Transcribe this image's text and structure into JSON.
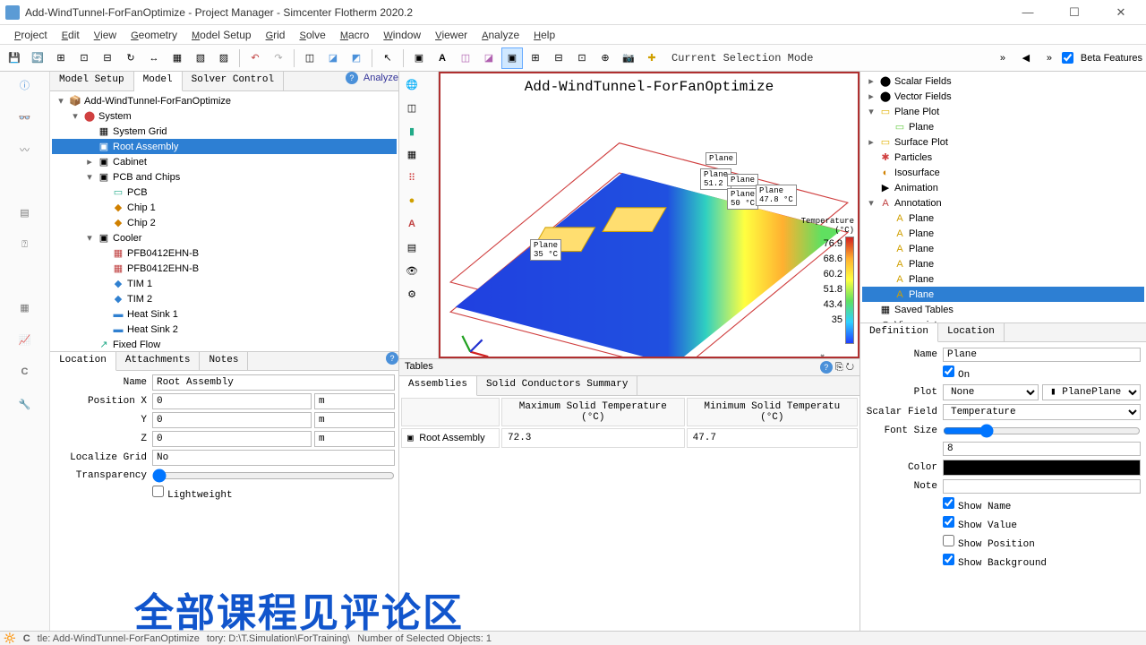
{
  "window": {
    "title": "Add-WindTunnel-ForFanOptimize - Project Manager - Simcenter Flotherm 2020.2"
  },
  "menu": [
    "Project",
    "Edit",
    "View",
    "Geometry",
    "Model Setup",
    "Grid",
    "Solve",
    "Macro",
    "Window",
    "Viewer",
    "Analyze",
    "Help"
  ],
  "toolbar_right": {
    "sel_mode": "Current Selection Mode",
    "beta": "Beta Features"
  },
  "left_tabs": [
    "Model Setup",
    "Model",
    "Solver Control"
  ],
  "left_tabs_active": 1,
  "tree": [
    {
      "depth": 0,
      "exp": "▾",
      "icon": "📦",
      "label": "Add-WindTunnel-ForFanOptimize"
    },
    {
      "depth": 1,
      "exp": "▾",
      "icon": "⬤",
      "label": "System",
      "iconColor": "#d04040"
    },
    {
      "depth": 2,
      "exp": "",
      "icon": "▦",
      "label": "System Grid"
    },
    {
      "depth": 2,
      "exp": "",
      "icon": "▣",
      "label": "Root Assembly",
      "sel": true
    },
    {
      "depth": 2,
      "exp": "▸",
      "icon": "▣",
      "label": "Cabinet"
    },
    {
      "depth": 2,
      "exp": "▾",
      "icon": "▣",
      "label": "PCB and Chips"
    },
    {
      "depth": 3,
      "exp": "",
      "icon": "▭",
      "label": "PCB",
      "iconColor": "#2a8"
    },
    {
      "depth": 3,
      "exp": "",
      "icon": "◆",
      "label": "Chip 1",
      "iconColor": "#d08000"
    },
    {
      "depth": 3,
      "exp": "",
      "icon": "◆",
      "label": "Chip 2",
      "iconColor": "#d08000"
    },
    {
      "depth": 2,
      "exp": "▾",
      "icon": "▣",
      "label": "Cooler"
    },
    {
      "depth": 3,
      "exp": "",
      "icon": "▦",
      "label": "PFB0412EHN-B",
      "iconColor": "#c04040"
    },
    {
      "depth": 3,
      "exp": "",
      "icon": "▦",
      "label": "PFB0412EHN-B",
      "iconColor": "#c04040"
    },
    {
      "depth": 3,
      "exp": "",
      "icon": "◆",
      "label": "TIM 1",
      "iconColor": "#3080d0"
    },
    {
      "depth": 3,
      "exp": "",
      "icon": "◆",
      "label": "TIM 2",
      "iconColor": "#3080d0"
    },
    {
      "depth": 3,
      "exp": "",
      "icon": "▬",
      "label": "Heat Sink 1",
      "iconColor": "#3080d0"
    },
    {
      "depth": 3,
      "exp": "",
      "icon": "▬",
      "label": "Heat Sink 2",
      "iconColor": "#3080d0"
    },
    {
      "depth": 2,
      "exp": "",
      "icon": "↗",
      "label": "Fixed Flow",
      "iconColor": "#2a8"
    }
  ],
  "prop_tabs": [
    "Location",
    "Attachments",
    "Notes"
  ],
  "prop_tabs_active": 0,
  "properties": {
    "name_label": "Name",
    "name": "Root Assembly",
    "posx_label": "Position X",
    "posx": "0",
    "posx_u": "m",
    "y_label": "Y",
    "y": "0",
    "y_u": "m",
    "z_label": "Z",
    "z": "0",
    "z_u": "m",
    "loc_label": "Localize Grid",
    "loc": "No",
    "trans_label": "Transparency",
    "light_label": "Lightweight"
  },
  "viewer_title": "Add-WindTunnel-ForFanOptimize",
  "colorbar_title": "Temperature (°C)",
  "colorbar": [
    "76.9",
    "68.6",
    "60.2",
    "51.8",
    "43.4",
    "35"
  ],
  "plane_annots": [
    {
      "l": 100,
      "t": 185,
      "t1": "Plane",
      "t2": "35 °C"
    },
    {
      "l": 296,
      "t": 88,
      "t1": "Plane",
      "t2": ""
    },
    {
      "l": 290,
      "t": 106,
      "t1": "Plane",
      "t2": "51.2"
    },
    {
      "l": 320,
      "t": 112,
      "t1": "Plane",
      "t2": ""
    },
    {
      "l": 320,
      "t": 128,
      "t1": "Plane",
      "t2": "50 °C"
    },
    {
      "l": 352,
      "t": 124,
      "t1": "Plane",
      "t2": "47.8 °C"
    }
  ],
  "tables": {
    "title": "Tables",
    "tabs": [
      "Assemblies",
      "Solid Conductors Summary"
    ],
    "tabs_active": 0,
    "headers": [
      "",
      "Maximum Solid Temperature (°C)",
      "Minimum Solid Temperatu (°C)"
    ],
    "row": [
      "Root Assembly",
      "72.3",
      "47.7"
    ]
  },
  "right_tree": [
    {
      "depth": 0,
      "exp": "▸",
      "icon": "⬤",
      "label": "Scalar Fields"
    },
    {
      "depth": 0,
      "exp": "▸",
      "icon": "⬤",
      "label": "Vector Fields"
    },
    {
      "depth": 0,
      "exp": "▾",
      "icon": "▭",
      "label": "Plane Plot",
      "iconColor": "#e0b000"
    },
    {
      "depth": 1,
      "exp": "",
      "icon": "▭",
      "label": "Plane",
      "iconColor": "#66cc44"
    },
    {
      "depth": 0,
      "exp": "▸",
      "icon": "▭",
      "label": "Surface Plot",
      "iconColor": "#e0b000"
    },
    {
      "depth": 0,
      "exp": "",
      "icon": "✱",
      "label": "Particles",
      "iconColor": "#d04040"
    },
    {
      "depth": 0,
      "exp": "",
      "icon": "◐",
      "label": "Isosurface",
      "iconColor": "#d08000"
    },
    {
      "depth": 0,
      "exp": "",
      "icon": "▶",
      "label": "Animation"
    },
    {
      "depth": 0,
      "exp": "▾",
      "icon": "A",
      "label": "Annotation",
      "iconColor": "#c04040"
    },
    {
      "depth": 1,
      "exp": "",
      "icon": "A",
      "label": "Plane",
      "iconColor": "#d0a000"
    },
    {
      "depth": 1,
      "exp": "",
      "icon": "A",
      "label": "Plane",
      "iconColor": "#d0a000"
    },
    {
      "depth": 1,
      "exp": "",
      "icon": "A",
      "label": "Plane",
      "iconColor": "#d0a000"
    },
    {
      "depth": 1,
      "exp": "",
      "icon": "A",
      "label": "Plane",
      "iconColor": "#d0a000"
    },
    {
      "depth": 1,
      "exp": "",
      "icon": "A",
      "label": "Plane",
      "iconColor": "#d0a000"
    },
    {
      "depth": 1,
      "exp": "",
      "icon": "A",
      "label": "Plane",
      "iconColor": "#d0a000",
      "sel": true
    },
    {
      "depth": 0,
      "exp": "",
      "icon": "▦",
      "label": "Saved Tables"
    },
    {
      "depth": 0,
      "exp": "",
      "icon": "◎",
      "label": "Viewpoint"
    }
  ],
  "right_tabs": [
    "Definition",
    "Location"
  ],
  "right_tabs_active": 0,
  "rprops": {
    "name_l": "Name",
    "name": "Plane",
    "on": "On",
    "plot_l": "Plot",
    "plot": "None",
    "plot2": "Plane",
    "scalar_l": "Scalar Field",
    "scalar": "Temperature",
    "font_l": "Font Size",
    "font": "8",
    "color_l": "Color",
    "note_l": "Note",
    "show_name": "Show Name",
    "show_value": "Show Value",
    "show_pos": "Show Position",
    "show_bg": "Show Background"
  },
  "watermark": "全部课程见评论区",
  "status": {
    "title": "tle: Add-WindTunnel-ForFanOptimize",
    "dir": "tory: D:\\T.Simulation\\ForTraining\\",
    "sel": "Number of Selected Objects: 1"
  },
  "analyze_label": "Analyze"
}
